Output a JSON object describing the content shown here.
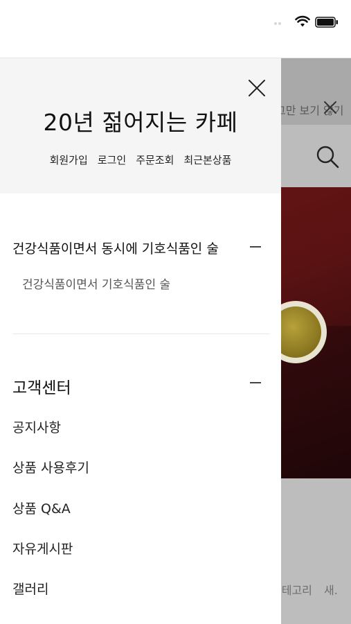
{
  "background_page": {
    "banner_text": "그만 보기 않기",
    "bottom_nav_text": "카테고리",
    "bottom_nav_text2": "새."
  },
  "drawer": {
    "title": "20년 젊어지는 카페",
    "links": [
      "회원가입",
      "로그인",
      "주문조회",
      "최근본상품"
    ],
    "category": {
      "title": "건강식품이면서 동시에 기호식품인 술",
      "items": [
        "건강식품이면서 기호식품인 술"
      ]
    },
    "customer_center": {
      "title": "고객센터",
      "items": [
        "공지사항",
        "상품 사용후기",
        "상품 Q&A",
        "자유게시판",
        "갤러리"
      ]
    }
  },
  "icons": {
    "status": [
      "wifi-icon",
      "battery-icon"
    ],
    "drawer": [
      "close-icon"
    ],
    "background": [
      "close-icon",
      "search-icon"
    ]
  },
  "colors": {
    "drawer_header_bg": "#f5f5f5",
    "hero_red": "#6b1717",
    "overlay_gray": "#bdbdbd"
  }
}
